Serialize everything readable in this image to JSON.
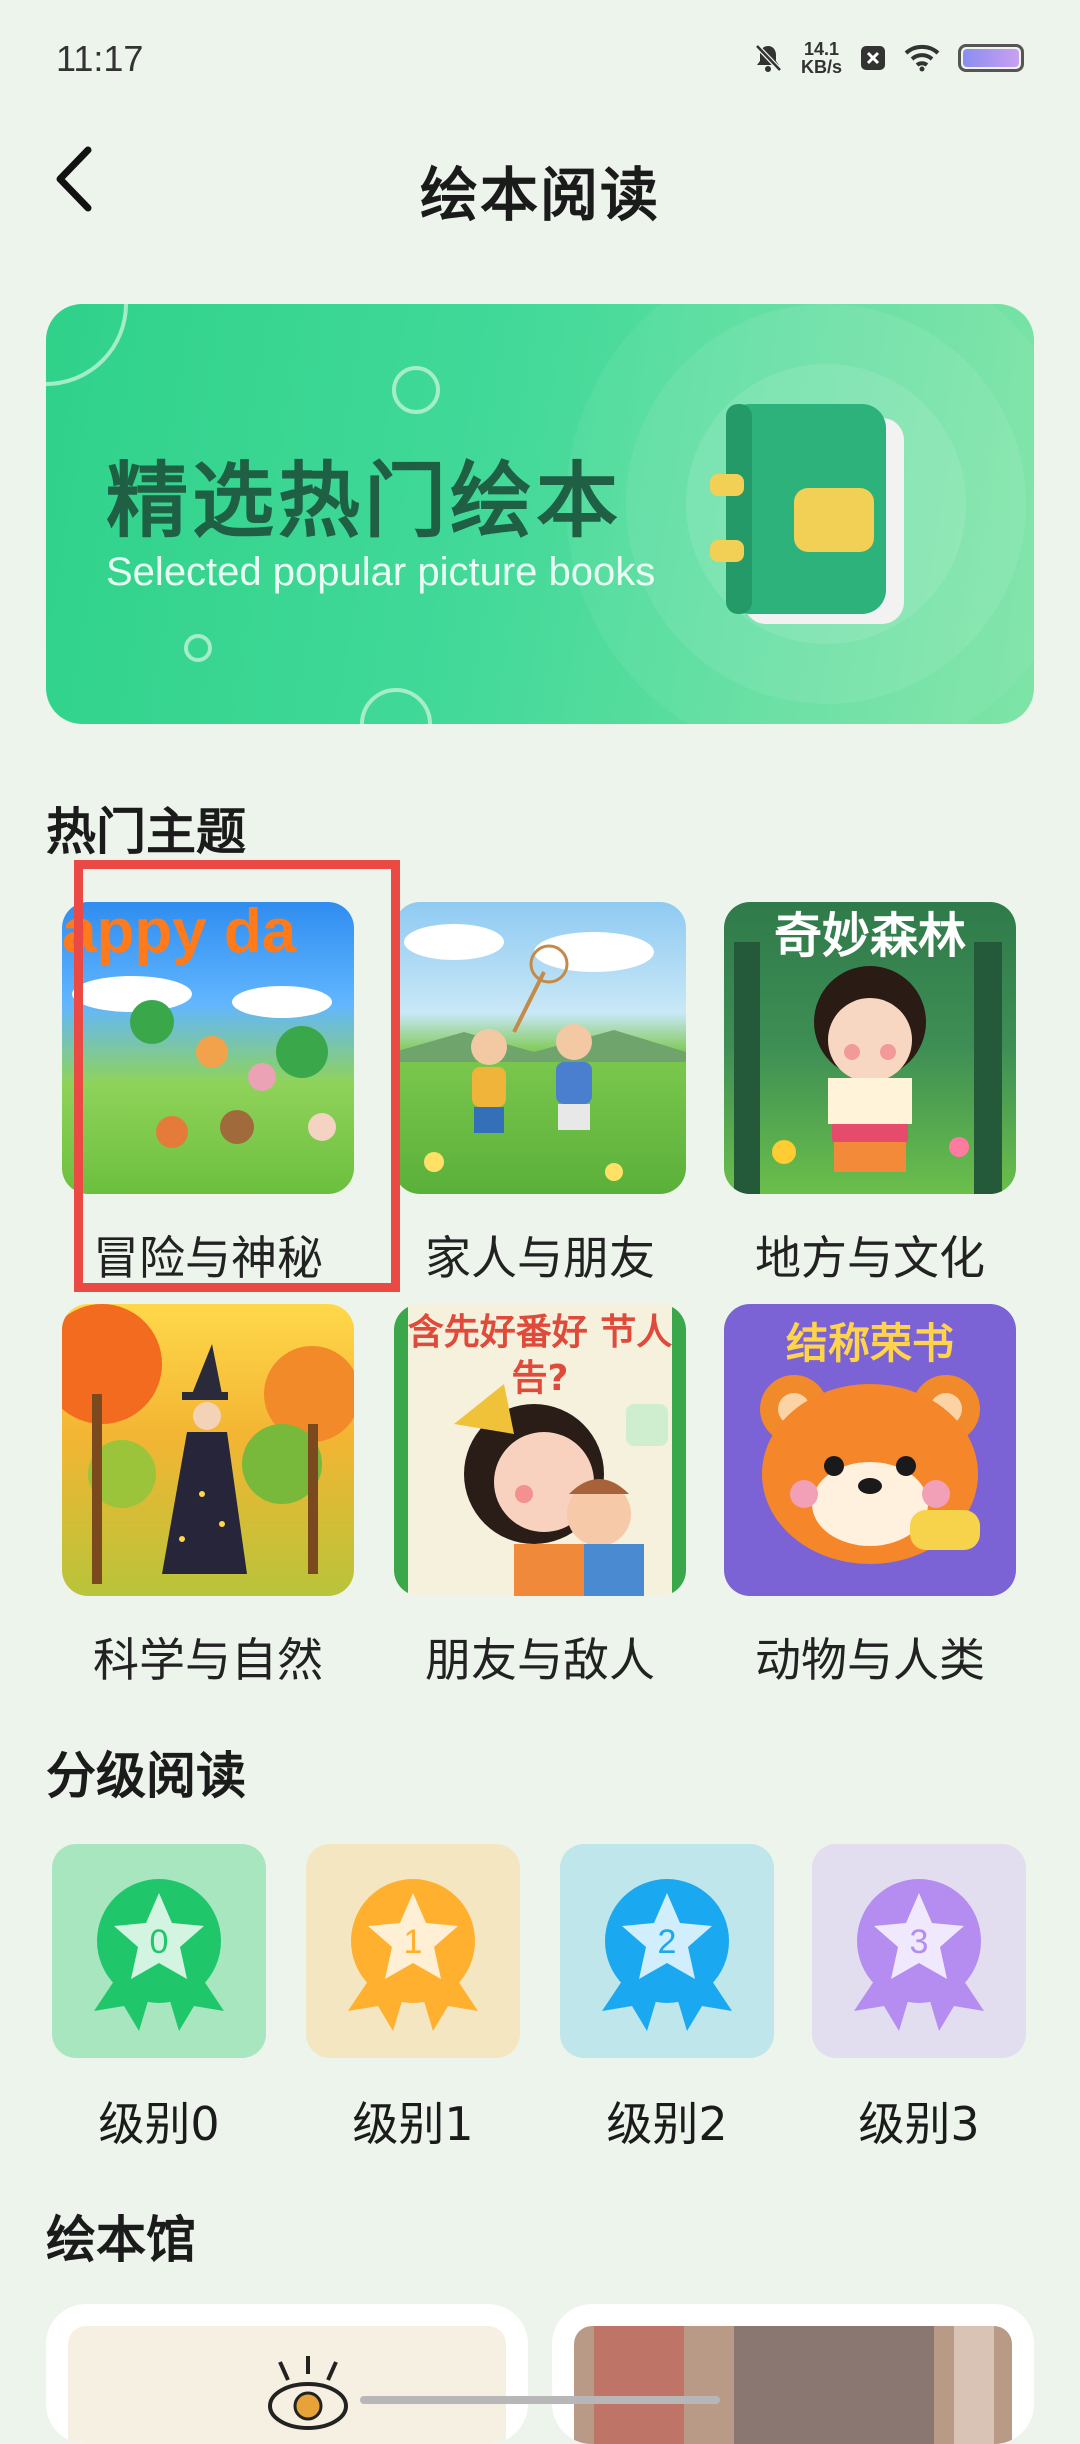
{
  "status": {
    "time": "11:17",
    "net_speed_value": "14.1",
    "net_speed_unit": "KB/s"
  },
  "header": {
    "title": "绘本阅读"
  },
  "banner": {
    "title": "精选热门绘本",
    "subtitle": "Selected popular picture books"
  },
  "sections": {
    "hot_topics": "热门主题",
    "graded_reading": "分级阅读",
    "library": "绘本馆"
  },
  "topics": [
    {
      "label": "冒险与神秘",
      "cover_text": "appy da"
    },
    {
      "label": "家人与朋友",
      "cover_text": ""
    },
    {
      "label": "地方与文化",
      "cover_text": "奇妙森林"
    },
    {
      "label": "科学与自然",
      "cover_text": ""
    },
    {
      "label": "朋友与敌人",
      "cover_text": "含先好番好 节人告?"
    },
    {
      "label": "动物与人类",
      "cover_text": "结称荣书"
    }
  ],
  "levels": [
    {
      "label": "级别0",
      "num": "0",
      "color": "#1fc76a",
      "bg": "#a8e6c0"
    },
    {
      "label": "级别1",
      "num": "1",
      "color": "#ffb02e",
      "bg": "#f5e6c2"
    },
    {
      "label": "级别2",
      "num": "2",
      "color": "#1aa8f0",
      "bg": "#bfe6ea"
    },
    {
      "label": "级别3",
      "num": "3",
      "color": "#b58cf0",
      "bg": "#e2def0"
    }
  ]
}
